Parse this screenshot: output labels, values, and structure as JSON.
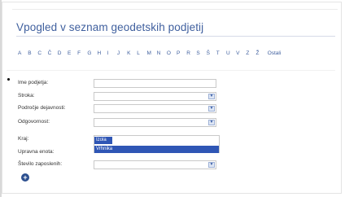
{
  "page": {
    "title": "Vpogled v seznam geodetskih podjetij"
  },
  "alphabet": {
    "letters": [
      "A",
      "B",
      "C",
      "Č",
      "D",
      "E",
      "F",
      "G",
      "H",
      "I",
      "J",
      "K",
      "L",
      "M",
      "N",
      "O",
      "P",
      "R",
      "S",
      "Š",
      "T",
      "U",
      "V",
      "Z",
      "Ž"
    ],
    "other_label": "Ostali"
  },
  "form": {
    "fields": [
      {
        "label": "Ime podjetja:",
        "type": "text",
        "value": ""
      },
      {
        "label": "Stroka:",
        "type": "select",
        "value": ""
      },
      {
        "label": "Področje dejavnosti:",
        "type": "select",
        "value": ""
      },
      {
        "label": "Odgovornost:",
        "type": "select",
        "value": ""
      },
      {
        "label": "Kraj:",
        "type": "listbox",
        "options": [
          "Izola",
          "Vrhnika"
        ]
      },
      {
        "label": "Upravna enota:",
        "type": "listbox",
        "value": ""
      },
      {
        "label": "Število zaposlenih:",
        "type": "select",
        "value": ""
      }
    ]
  },
  "actions": {
    "add_icon": "plus-circle-icon"
  }
}
